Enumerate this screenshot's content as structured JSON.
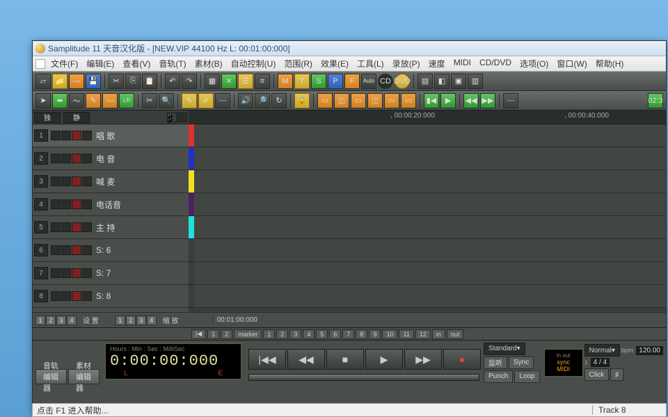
{
  "title": "Samplitude 11 天音汉化版 - [NEW.VIP   44100 Hz L: 00:01:00:000]",
  "menu": [
    "文件(F)",
    "编辑(E)",
    "查看(V)",
    "音轨(T)",
    "素材(B)",
    "自动控制(U)",
    "范围(R)",
    "效果(E)",
    "工具(L)",
    "录放(P)",
    "速度",
    "MIDI",
    "CD/DVD",
    "选项(O)",
    "窗口(W)",
    "帮助(H)"
  ],
  "header_buttons": {
    "solo": "独",
    "mute": "静"
  },
  "ruler_marks": [
    {
      "pos": 290,
      "text": "00:00:20:000"
    },
    {
      "pos": 540,
      "text": "00:00:40:000"
    }
  ],
  "tracks": [
    {
      "num": "1",
      "name": "唱 歌",
      "color": "#e03030"
    },
    {
      "num": "2",
      "name": "电 音",
      "color": "#2030c0"
    },
    {
      "num": "3",
      "name": "喊 麦",
      "color": "#f0e020"
    },
    {
      "num": "4",
      "name": "电话音",
      "color": "#502060"
    },
    {
      "num": "5",
      "name": "主 持",
      "color": "#20e0e0"
    },
    {
      "num": "6",
      "name": "S: 6",
      "color": "#3a3e3a"
    },
    {
      "num": "7",
      "name": "S: 7",
      "color": "#3a3e3a"
    },
    {
      "num": "8",
      "name": "S: 8",
      "color": "#3a3e3a"
    }
  ],
  "lower_groups": {
    "left_label": "设 置",
    "right_label": "缩 放",
    "nums": [
      "1",
      "2",
      "3",
      "4"
    ]
  },
  "ruler_bottom": "00:01:00:000",
  "marker_row": {
    "prefix": [
      "|◀",
      "1",
      "2"
    ],
    "label": "marker",
    "nums": [
      "1",
      "2",
      "3",
      "4",
      "5",
      "6",
      "7",
      "8",
      "9",
      "10",
      "11",
      "12"
    ],
    "inout": [
      "in",
      "out"
    ]
  },
  "time": {
    "label": "Hours : Min : Sec : MilliSec",
    "value": "0:00:00:000",
    "l": "L",
    "e": "E"
  },
  "combo1": "Standard",
  "combo2": "Normal",
  "bpm_label": "bpm",
  "bpm_value": "120.00",
  "btns": {
    "listen": "监听",
    "sync": "Sync",
    "punch": "Punch",
    "loop": "Loop",
    "click": "Click"
  },
  "sync_box": {
    "sync": "sync",
    "midi": "MIDI",
    "inout": "in  out"
  },
  "sig": "4 / 4",
  "tabs": [
    "音轨编辑器",
    "素材编辑器"
  ],
  "clock_pill": "02:3",
  "status": {
    "help": "点击 F1 进入帮助...",
    "track": "Track 8"
  }
}
